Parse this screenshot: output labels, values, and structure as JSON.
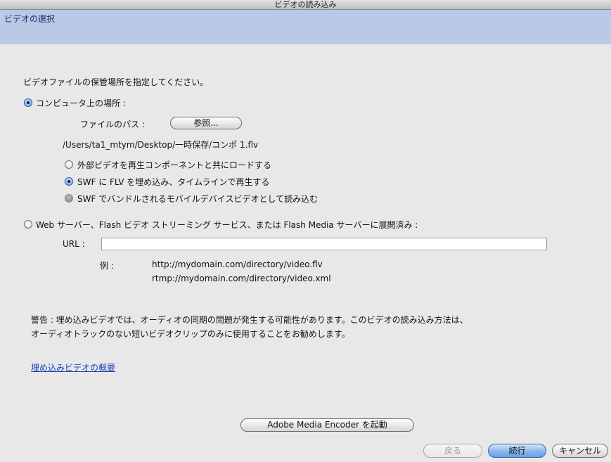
{
  "window": {
    "title": "ビデオの読み込み"
  },
  "step": {
    "title": "ビデオの選択"
  },
  "prompt": "ビデオファイルの保管場所を指定してください。",
  "location_local": {
    "label": "コンピュータ上の場所 :",
    "checked": true,
    "file_path_label": "ファイルのパス :",
    "browse_button": "参照...",
    "path_value": "/Users/ta1_mtym/Desktop/一時保存/コンポ 1.flv",
    "options": [
      {
        "label": "外部ビデオを再生コンポーネントと共にロードする",
        "state": "unchecked"
      },
      {
        "label": "SWF に FLV を埋め込み、タイムラインで再生する",
        "state": "checked"
      },
      {
        "label": "SWF でバンドルされるモバイルデバイスビデオとして読み込む",
        "state": "disabled"
      }
    ]
  },
  "location_server": {
    "label": "Web サーバー、Flash ビデオ ストリーミング サービス、または Flash Media サーバーに展開済み :",
    "checked": false,
    "url_label": "URL :",
    "url_value": "",
    "example_label": "例 :",
    "examples": [
      "http://mydomain.com/directory/video.flv",
      "rtmp://mydomain.com/directory/video.xml"
    ]
  },
  "warning": {
    "line1": "警告 : 埋め込みビデオでは、オーディオの同期の問題が発生する可能性があります。このビデオの読み込み方法は、",
    "line2": "オーディオトラックのない短いビデオクリップのみに使用することをお勧めします。"
  },
  "about_link": "埋め込みビデオの概要",
  "encoder_button": "Adobe Media Encoder を起動",
  "footer": {
    "back": "戻る",
    "continue": "続行",
    "cancel": "キャンセル"
  }
}
